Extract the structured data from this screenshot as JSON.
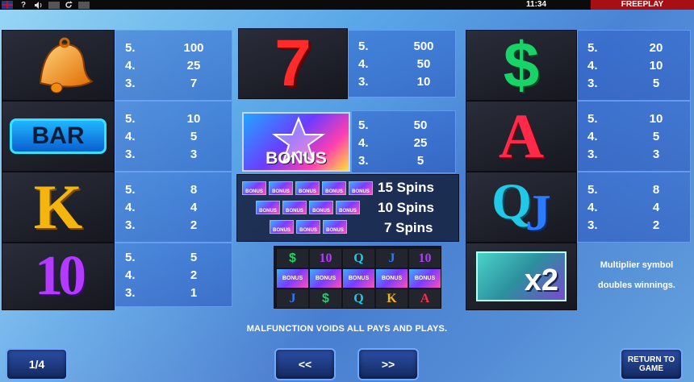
{
  "topbar": {
    "help_label": "?",
    "time": "11:34",
    "mode": "FREEPLAY"
  },
  "paytable": {
    "bell": {
      "rows": [
        {
          "n": "5.",
          "v": "100"
        },
        {
          "n": "4.",
          "v": "25"
        },
        {
          "n": "3.",
          "v": "7"
        }
      ]
    },
    "bar": {
      "label": "BAR",
      "rows": [
        {
          "n": "5.",
          "v": "10"
        },
        {
          "n": "4.",
          "v": "5"
        },
        {
          "n": "3.",
          "v": "3"
        }
      ]
    },
    "k": {
      "label": "K",
      "rows": [
        {
          "n": "5.",
          "v": "8"
        },
        {
          "n": "4.",
          "v": "4"
        },
        {
          "n": "3.",
          "v": "2"
        }
      ]
    },
    "ten": {
      "label": "10",
      "rows": [
        {
          "n": "5.",
          "v": "5"
        },
        {
          "n": "4.",
          "v": "2"
        },
        {
          "n": "3.",
          "v": "1"
        }
      ]
    },
    "seven": {
      "label": "7",
      "rows": [
        {
          "n": "5.",
          "v": "500"
        },
        {
          "n": "4.",
          "v": "50"
        },
        {
          "n": "3.",
          "v": "10"
        }
      ]
    },
    "bonus": {
      "label": "BONUS",
      "rows": [
        {
          "n": "5.",
          "v": "50"
        },
        {
          "n": "4.",
          "v": "25"
        },
        {
          "n": "3.",
          "v": "5"
        }
      ]
    },
    "dollar": {
      "label": "$",
      "rows": [
        {
          "n": "5.",
          "v": "20"
        },
        {
          "n": "4.",
          "v": "10"
        },
        {
          "n": "3.",
          "v": "5"
        }
      ]
    },
    "a": {
      "label": "A",
      "rows": [
        {
          "n": "5.",
          "v": "10"
        },
        {
          "n": "4.",
          "v": "5"
        },
        {
          "n": "3.",
          "v": "3"
        }
      ]
    },
    "qj": {
      "label_q": "Q",
      "label_j": "J",
      "rows": [
        {
          "n": "5.",
          "v": "8"
        },
        {
          "n": "4.",
          "v": "4"
        },
        {
          "n": "3.",
          "v": "2"
        }
      ]
    },
    "multiplier": {
      "label": "x2",
      "description": "Multiplier symbol doubles winnings."
    }
  },
  "free_spins": [
    {
      "label": "15 Spins"
    },
    {
      "label": "10 Spins"
    },
    {
      "label": "7 Spins"
    }
  ],
  "mini_bonus_label": "BONUS",
  "example_grid": {
    "row1": [
      "$",
      "10",
      "Q",
      "J",
      "10"
    ],
    "row2": [
      "BONUS",
      "BONUS",
      "BONUS",
      "BONUS",
      "BONUS"
    ],
    "row3": [
      "J",
      "$",
      "Q",
      "K",
      "A"
    ]
  },
  "footer": {
    "disclaimer": "MALFUNCTION VOIDS ALL PAYS AND PLAYS.",
    "page": "1/4",
    "prev": "<<",
    "next": ">>",
    "return": "RETURN TO GAME"
  },
  "colors": {
    "freeplay_bg": "#a60f14",
    "panel_border": "#78aaff",
    "button_bg": "#1c3670"
  }
}
